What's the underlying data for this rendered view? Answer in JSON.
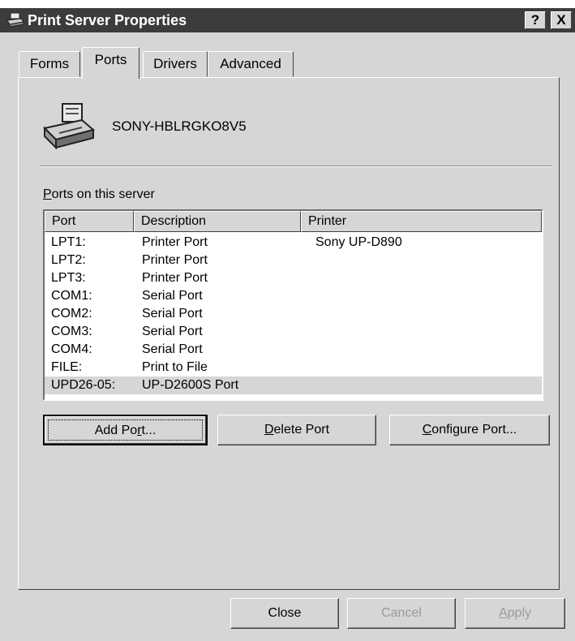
{
  "window": {
    "title": "Print Server Properties",
    "help_label": "?",
    "close_label": "X"
  },
  "tabs": [
    {
      "label": "Forms",
      "active": false
    },
    {
      "label": "Ports",
      "active": true
    },
    {
      "label": "Drivers",
      "active": false
    },
    {
      "label": "Advanced",
      "active": false
    }
  ],
  "server": {
    "name": "SONY-HBLRGKO8V5",
    "icon": "printer-server-icon"
  },
  "ports_section": {
    "label_first": "P",
    "label_rest": "orts on this server",
    "columns": [
      "Port",
      "Description",
      "Printer"
    ],
    "rows": [
      {
        "port": "LPT1:",
        "description": "Printer Port",
        "printer": "Sony UP-D890"
      },
      {
        "port": "LPT2:",
        "description": "Printer Port",
        "printer": ""
      },
      {
        "port": "LPT3:",
        "description": "Printer Port",
        "printer": ""
      },
      {
        "port": "COM1:",
        "description": "Serial Port",
        "printer": ""
      },
      {
        "port": "COM2:",
        "description": "Serial Port",
        "printer": ""
      },
      {
        "port": "COM3:",
        "description": "Serial Port",
        "printer": ""
      },
      {
        "port": "COM4:",
        "description": "Serial Port",
        "printer": ""
      },
      {
        "port": "FILE:",
        "description": "Print to File",
        "printer": ""
      },
      {
        "port": "UPD26-05:",
        "description": "UP-D2600S Port",
        "printer": "",
        "selected": true
      }
    ]
  },
  "buttons": {
    "add_port_pre": "Add Po",
    "add_port_mn": "r",
    "add_port_post": "t...",
    "delete_port_mn": "D",
    "delete_port_post": "elete Port",
    "configure_port_mn": "C",
    "configure_port_post": "onfigure Port...",
    "close": "Close",
    "cancel": "Cancel",
    "apply_mn": "A",
    "apply_post": "pply"
  }
}
